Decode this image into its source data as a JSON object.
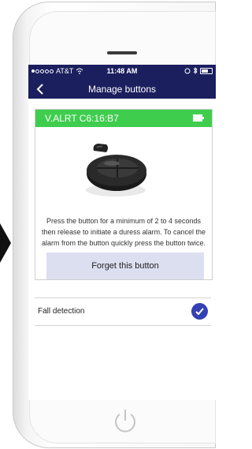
{
  "status_bar": {
    "carrier": "AT&T",
    "time": "11:48 AM"
  },
  "nav": {
    "title": "Manage buttons"
  },
  "device": {
    "id": "V.ALRT C6:16:B7",
    "battery_icon": "battery-icon",
    "instructions": "Press the button for a minimum of 2 to 4 seconds then release to initiate a duress alarm. To cancel the alarm from the button quickly press the button twice."
  },
  "actions": {
    "forget_label": "Forget this button"
  },
  "settings": {
    "fall_detection_label": "Fall detection",
    "fall_detection_enabled": true
  },
  "colors": {
    "nav_bg": "#1b1f5e",
    "device_header": "#3fcd4e",
    "forget_bg": "#dcdff0",
    "check": "#3341b5"
  }
}
